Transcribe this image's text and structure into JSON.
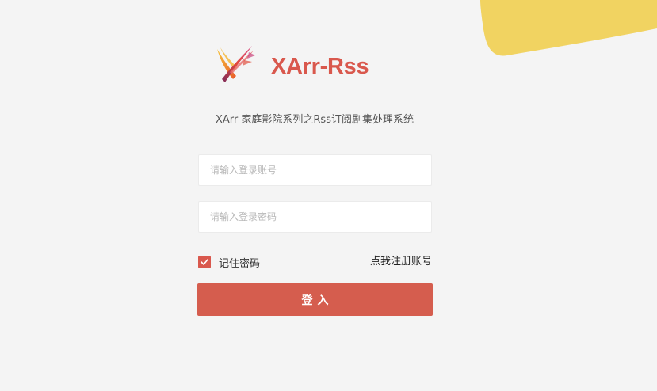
{
  "brand": {
    "name": "XArr-Rss",
    "logo_icon": "x-feather-logo-icon",
    "color": "#d9584d"
  },
  "subtitle": "XArr 家庭影院系列之Rss订阅剧集处理系统",
  "form": {
    "account_placeholder": "请输入登录账号",
    "account_value": "",
    "password_placeholder": "请输入登录密码",
    "password_value": "",
    "remember_label": "记住密码",
    "remember_checked": true,
    "register_link": "点我注册账号",
    "login_button": "登入"
  },
  "theme": {
    "accent": "#d55d4e",
    "background": "#f4f4f4",
    "blob": "#f1d361"
  }
}
